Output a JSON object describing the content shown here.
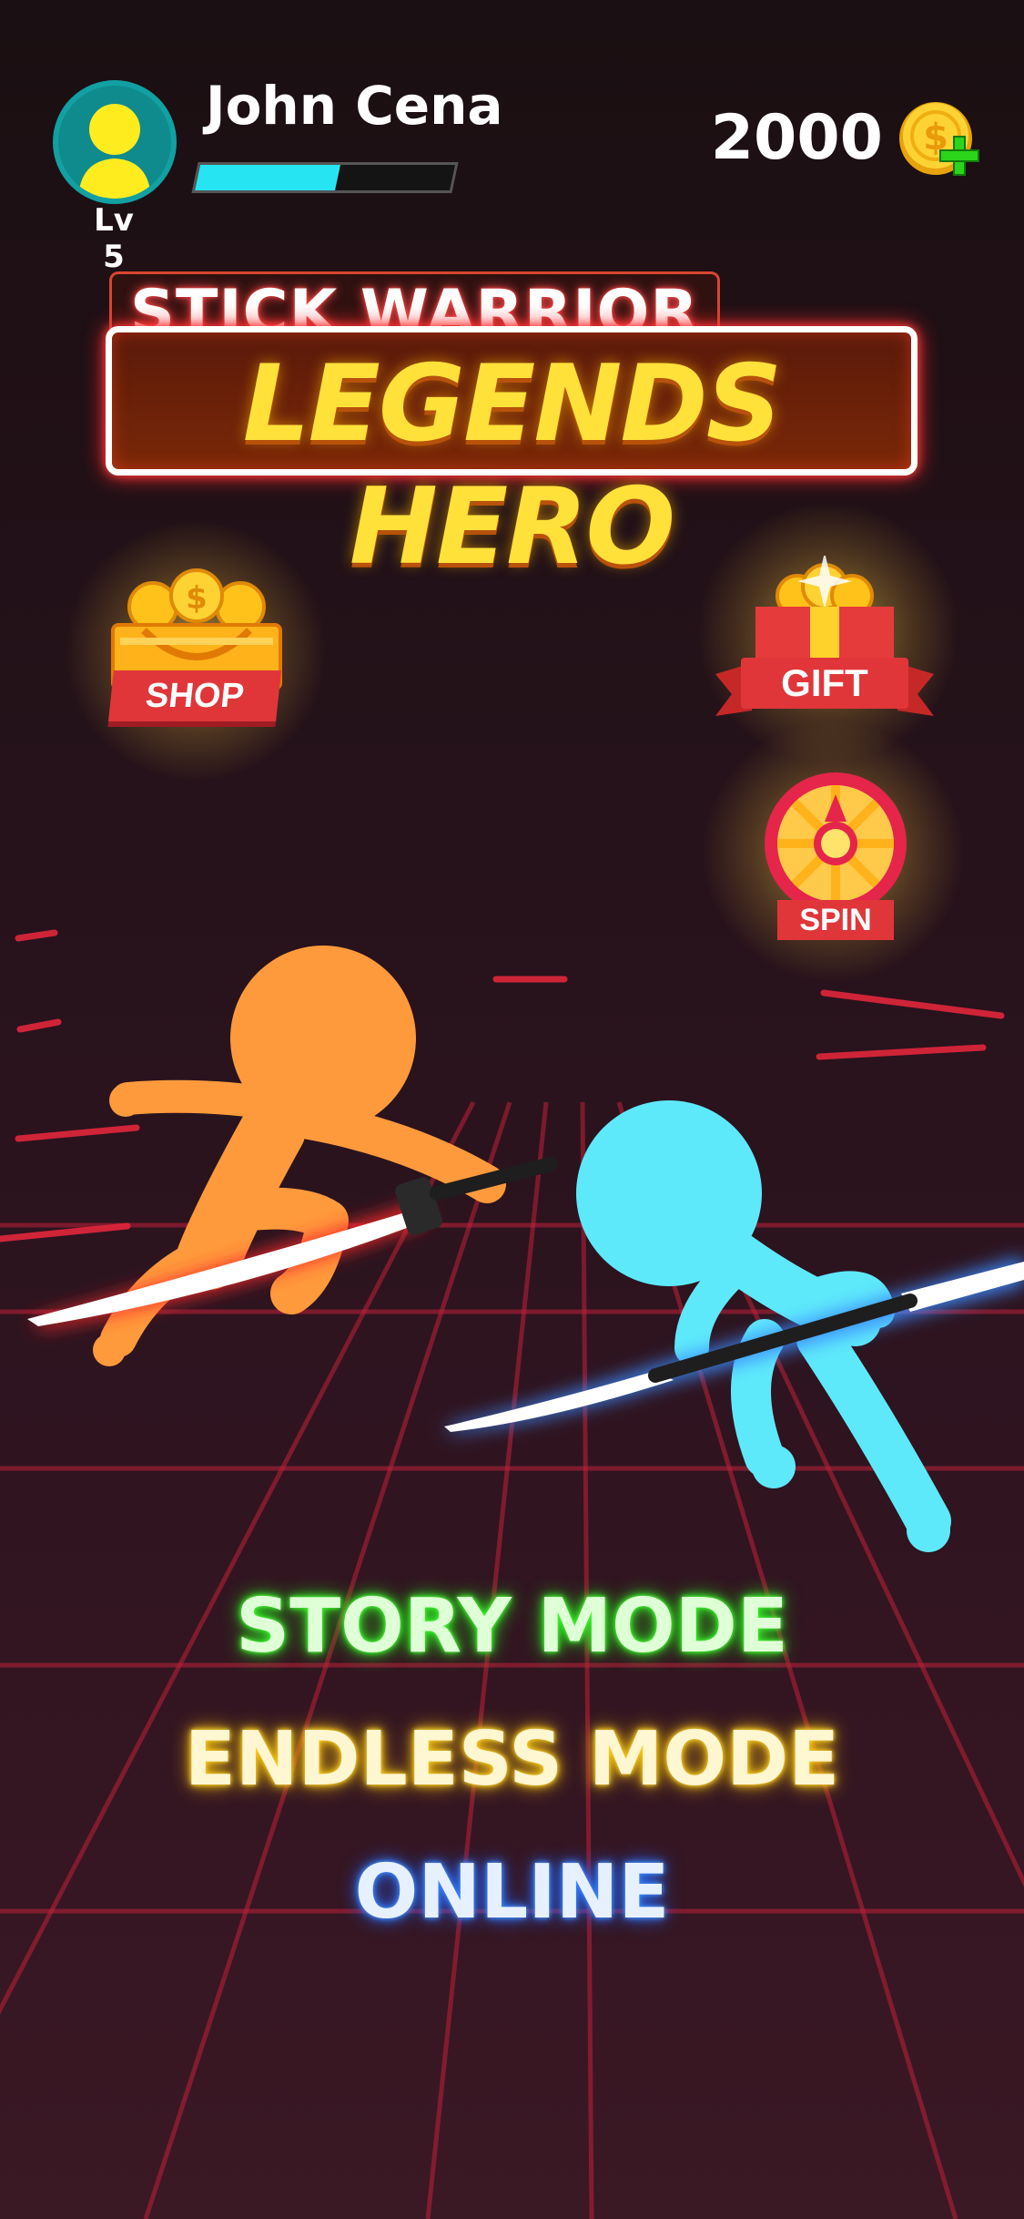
{
  "player": {
    "name": "John Cena",
    "level_label": "Lv 5",
    "xp_progress": 0.55
  },
  "currency": {
    "coins": "2000",
    "icon": "gold-coin-icon",
    "add_icon": "plus-icon"
  },
  "logo": {
    "line1": "STICK WARRIOR",
    "line2": "LEGENDS HERO"
  },
  "rewards": {
    "shop_label": "SHOP",
    "gift_label": "GIFT",
    "spin_label": "SPIN"
  },
  "menu": {
    "story": "STORY MODE",
    "endless": "ENDLESS MODE",
    "online": "ONLINE"
  },
  "colors": {
    "story": "#3aff2a",
    "endless": "#ffd21a",
    "online": "#3a8bff",
    "xp": "#27e4f2",
    "orange_fighter": "#ff9a3c",
    "cyan_fighter": "#5ee9fb"
  }
}
